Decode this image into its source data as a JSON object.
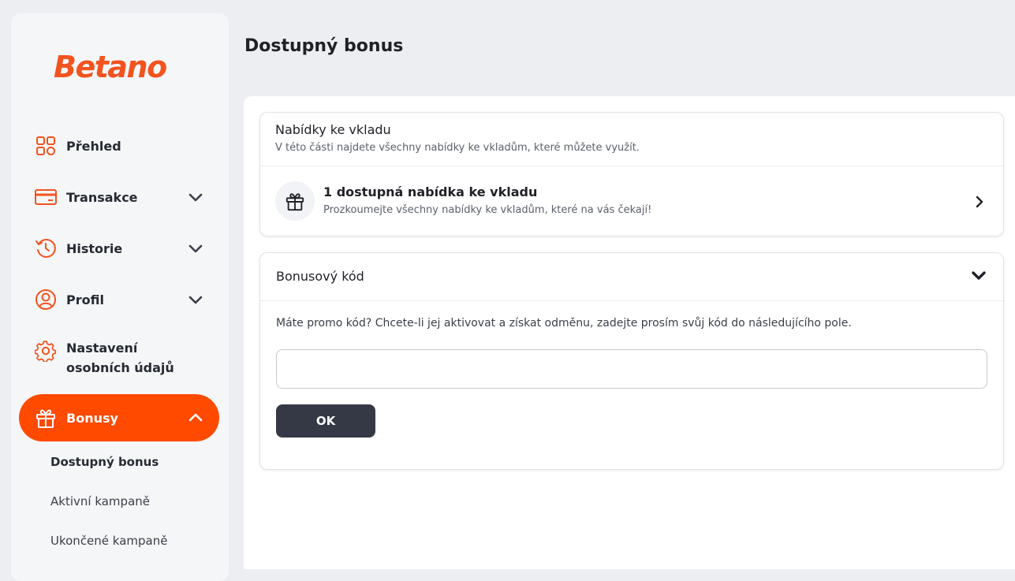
{
  "brand": {
    "logo_text": "Betano",
    "accent": "#ff4a00",
    "logo_color": "#f2531f"
  },
  "sidebar": {
    "items": [
      {
        "label": "Přehled",
        "icon": "grid-icon",
        "has_chevron": false
      },
      {
        "label": "Transakce",
        "icon": "card-icon",
        "has_chevron": true
      },
      {
        "label": "Historie",
        "icon": "history-icon",
        "has_chevron": true
      },
      {
        "label": "Profil",
        "icon": "user-icon",
        "has_chevron": true
      },
      {
        "label_line1": "Nastavení",
        "label_line2": "osobních údajů",
        "icon": "gear-icon",
        "has_chevron": false
      },
      {
        "label": "Bonusy",
        "icon": "gift-icon",
        "has_chevron": true,
        "active": true
      }
    ],
    "subitems": [
      {
        "label": "Dostupný bonus",
        "current": true
      },
      {
        "label": "Aktivní kampaně"
      },
      {
        "label": "Ukončené kampaně"
      }
    ]
  },
  "page": {
    "title": "Dostupný bonus"
  },
  "deposit_offers": {
    "title": "Nabídky ke vkladu",
    "subtitle": "V této části najdete všechny nabídky ke vkladům, které můžete využít.",
    "offer_title": "1 dostupná nabídka ke vkladu",
    "offer_subtitle": "Prozkoumejte všechny nabídky ke vkladům, které na vás čekají!"
  },
  "bonus_code": {
    "title": "Bonusový kód",
    "description": "Máte promo kód? Chcete-li jej aktivovat a získat odměnu, zadejte prosím svůj kód do následujícího pole.",
    "input_value": "",
    "button_label": "OK"
  }
}
